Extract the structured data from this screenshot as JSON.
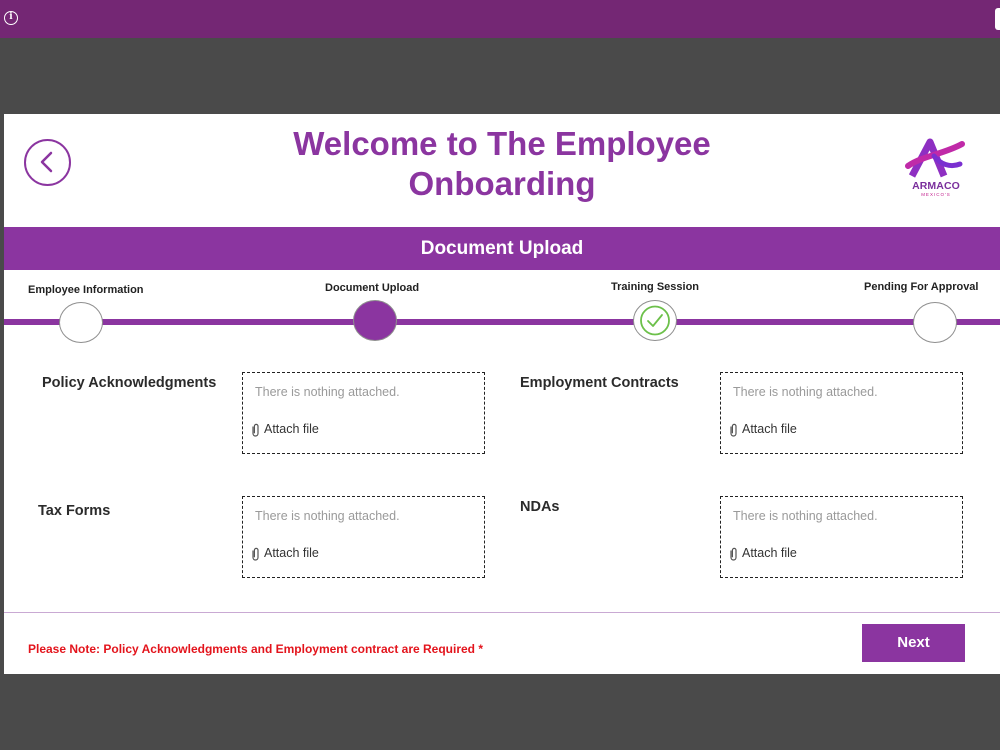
{
  "topbar": {
    "color": "#742774",
    "info_icon": "info-icon",
    "info_glyph": "i"
  },
  "header": {
    "title_line1": "Welcome to The Employee",
    "title_line2": "Onboarding",
    "back_icon": "chevron-left-icon",
    "logo": {
      "brand": "ARMACO",
      "sub": "MEXICO'S"
    }
  },
  "section": {
    "title": "Document Upload",
    "accent": "#8b35a0"
  },
  "steps": [
    {
      "label": "Employee Information",
      "state": "pending"
    },
    {
      "label": "Document Upload",
      "state": "current"
    },
    {
      "label": "Training Session",
      "state": "completed"
    },
    {
      "label": "Pending For Approval",
      "state": "pending"
    }
  ],
  "uploads": [
    {
      "label": "Policy Acknowledgments",
      "empty_text": "There is nothing attached.",
      "attach_label": "Attach file"
    },
    {
      "label": "Employment Contracts",
      "empty_text": "There is nothing attached.",
      "attach_label": "Attach file"
    },
    {
      "label": "Tax Forms",
      "empty_text": "There is nothing attached.",
      "attach_label": "Attach file"
    },
    {
      "label": "NDAs",
      "empty_text": "There is nothing attached.",
      "attach_label": "Attach file"
    }
  ],
  "footer": {
    "note": "Please Note:  Policy Acknowledgments and Employment contract are Required *",
    "note_color": "#e3141c",
    "next_label": "Next"
  },
  "colors": {
    "check": "#6cc04a",
    "background": "#4a4a4a"
  }
}
